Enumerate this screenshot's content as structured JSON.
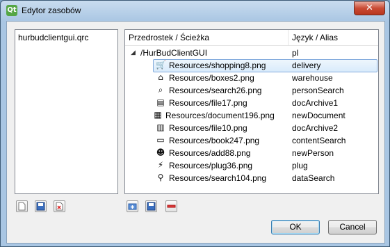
{
  "window": {
    "title": "Edytor zasobów",
    "close_label": "✕",
    "app_icon_label": "Qt"
  },
  "files": [
    "hurbudclientgui.qrc"
  ],
  "tree": {
    "columns": [
      "Przedrostek / Ścieżka",
      "Język / Alias"
    ],
    "prefix": {
      "label": "/HurBudClientGUI",
      "lang": "pl",
      "expanded": true
    },
    "rows": [
      {
        "icon": "cart-icon",
        "glyph": "🛒",
        "path": "Resources/shopping8.png",
        "alias": "delivery",
        "selected": true
      },
      {
        "icon": "warehouse-icon",
        "glyph": "⌂",
        "path": "Resources/boxes2.png",
        "alias": "warehouse"
      },
      {
        "icon": "search-person-icon",
        "glyph": "⌕",
        "path": "Resources/search26.png",
        "alias": "personSearch"
      },
      {
        "icon": "file-icon",
        "glyph": "▤",
        "path": "Resources/file17.png",
        "alias": "docArchive1"
      },
      {
        "icon": "document-icon",
        "glyph": "▦",
        "path": "Resources/document196.png",
        "alias": "newDocument"
      },
      {
        "icon": "file-archive-icon",
        "glyph": "▥",
        "path": "Resources/file10.png",
        "alias": "docArchive2"
      },
      {
        "icon": "book-icon",
        "glyph": "▭",
        "path": "Resources/book247.png",
        "alias": "contentSearch"
      },
      {
        "icon": "add-person-icon",
        "glyph": "☻",
        "path": "Resources/add88.png",
        "alias": "newPerson"
      },
      {
        "icon": "plug-icon",
        "glyph": "⚡",
        "path": "Resources/plug36.png",
        "alias": "plug"
      },
      {
        "icon": "search-icon",
        "glyph": "⚲",
        "path": "Resources/search104.png",
        "alias": "dataSearch"
      }
    ]
  },
  "buttons": {
    "ok": "OK",
    "cancel": "Cancel"
  }
}
